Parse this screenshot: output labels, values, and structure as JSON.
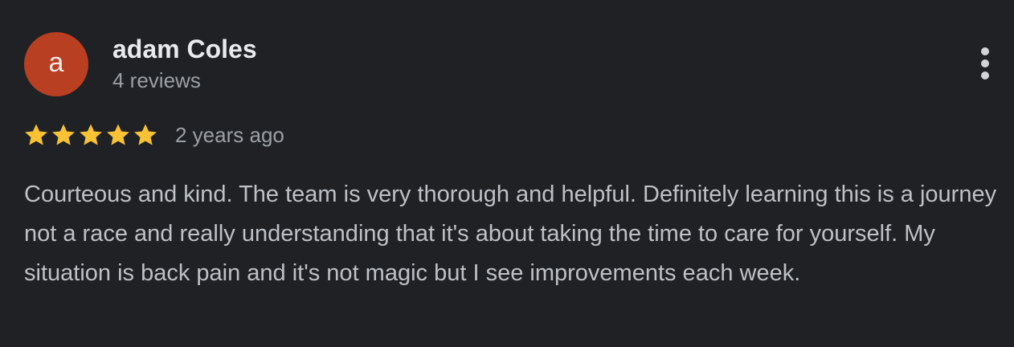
{
  "review": {
    "avatar_letter": "a",
    "avatar_color": "#b93f22",
    "author_name": "adam Coles",
    "review_count": "4 reviews",
    "rating": 5,
    "rating_max": 5,
    "star_color": "#f8c233",
    "date": "2 years ago",
    "text": "Courteous and kind. The team is very thorough and helpful. Definitely learning this is a journey not a race and really understanding that it's about taking the time to care for yourself. My situation is back pain and it's not magic but I see improvements each week.",
    "menu_icon": "more-vert-icon"
  },
  "colors": {
    "background": "#202124",
    "name_text": "#e8eaed",
    "secondary_text": "#9aa0a6",
    "body_text": "#bdc1c6"
  }
}
